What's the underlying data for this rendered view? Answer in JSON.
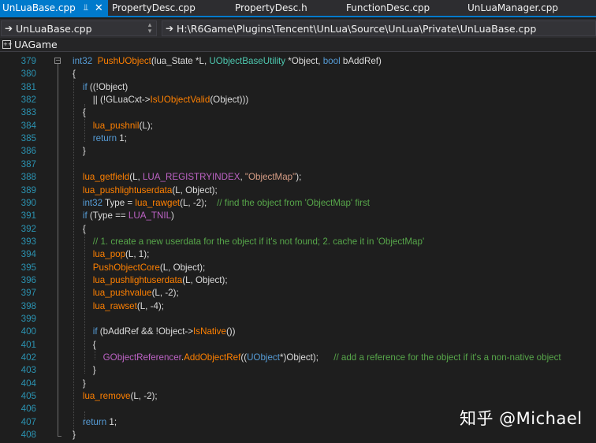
{
  "tabs": [
    {
      "label": "UnLuaBase.cpp",
      "active": true
    },
    {
      "label": "PropertyDesc.cpp",
      "active": false
    },
    {
      "label": "PropertyDesc.h",
      "active": false
    },
    {
      "label": "FunctionDesc.cpp",
      "active": false
    },
    {
      "label": "UnLuaManager.cpp",
      "active": false
    }
  ],
  "nav": {
    "file_combo": "UnLuaBase.cpp",
    "path_combo": "H:\\R6Game\\Plugins\\Tencent\\UnLua\\Source\\UnLua\\Private\\UnLuaBase.cpp"
  },
  "project": {
    "name": "UAGame"
  },
  "code_lines": [
    {
      "n": "379",
      "tokens": [
        [
          "kw",
          "int32"
        ],
        [
          "",
          "  "
        ],
        [
          "fn",
          "PushUObject"
        ],
        [
          "",
          "(lua_State *L, "
        ],
        [
          "ty",
          "UObjectBaseUtility"
        ],
        [
          "",
          " *Object, "
        ],
        [
          "kw",
          "bool"
        ],
        [
          "",
          " bAddRef)"
        ]
      ]
    },
    {
      "n": "380",
      "tokens": [
        [
          "",
          "{"
        ]
      ]
    },
    {
      "n": "381",
      "tokens": [
        [
          "",
          "    "
        ],
        [
          "kw",
          "if"
        ],
        [
          "",
          " ((!Object)"
        ]
      ]
    },
    {
      "n": "382",
      "tokens": [
        [
          "",
          "        || (!GLuaCxt->"
        ],
        [
          "fn",
          "IsUObjectValid"
        ],
        [
          "",
          "(Object)))"
        ]
      ]
    },
    {
      "n": "383",
      "tokens": [
        [
          "",
          "    {"
        ]
      ]
    },
    {
      "n": "384",
      "tokens": [
        [
          "",
          "        "
        ],
        [
          "fn",
          "lua_pushnil"
        ],
        [
          "",
          "(L);"
        ]
      ]
    },
    {
      "n": "385",
      "tokens": [
        [
          "",
          "        "
        ],
        [
          "kw",
          "return"
        ],
        [
          "",
          " 1;"
        ]
      ]
    },
    {
      "n": "386",
      "tokens": [
        [
          "",
          "    }"
        ]
      ]
    },
    {
      "n": "387",
      "tokens": []
    },
    {
      "n": "388",
      "tokens": [
        [
          "",
          "    "
        ],
        [
          "fn",
          "lua_getfield"
        ],
        [
          "",
          "(L, "
        ],
        [
          "mac",
          "LUA_REGISTRYINDEX"
        ],
        [
          "",
          ", "
        ],
        [
          "st",
          "\"ObjectMap\""
        ],
        [
          "",
          ");"
        ]
      ]
    },
    {
      "n": "389",
      "tokens": [
        [
          "",
          "    "
        ],
        [
          "fn",
          "lua_pushlightuserdata"
        ],
        [
          "",
          "(L, Object);"
        ]
      ]
    },
    {
      "n": "390",
      "tokens": [
        [
          "",
          "    "
        ],
        [
          "kw",
          "int32"
        ],
        [
          "",
          " Type = "
        ],
        [
          "fn",
          "lua_rawget"
        ],
        [
          "",
          "(L, -2);    "
        ],
        [
          "cm",
          "// find the object from 'ObjectMap' first"
        ]
      ]
    },
    {
      "n": "391",
      "tokens": [
        [
          "",
          "    "
        ],
        [
          "kw",
          "if"
        ],
        [
          "",
          " (Type == "
        ],
        [
          "mac",
          "LUA_TNIL"
        ],
        [
          "",
          ")"
        ]
      ]
    },
    {
      "n": "392",
      "tokens": [
        [
          "",
          "    {"
        ]
      ]
    },
    {
      "n": "393",
      "tokens": [
        [
          "",
          "        "
        ],
        [
          "cm",
          "// 1. create a new userdata for the object if it's not found; 2. cache it in 'ObjectMap'"
        ]
      ]
    },
    {
      "n": "394",
      "tokens": [
        [
          "",
          "        "
        ],
        [
          "fn",
          "lua_pop"
        ],
        [
          "",
          "(L, 1);"
        ]
      ]
    },
    {
      "n": "395",
      "tokens": [
        [
          "",
          "        "
        ],
        [
          "fn",
          "PushObjectCore"
        ],
        [
          "",
          "(L, Object);"
        ]
      ]
    },
    {
      "n": "396",
      "tokens": [
        [
          "",
          "        "
        ],
        [
          "fn",
          "lua_pushlightuserdata"
        ],
        [
          "",
          "(L, Object);"
        ]
      ]
    },
    {
      "n": "397",
      "tokens": [
        [
          "",
          "        "
        ],
        [
          "fn",
          "lua_pushvalue"
        ],
        [
          "",
          "(L, -2);"
        ]
      ]
    },
    {
      "n": "398",
      "tokens": [
        [
          "",
          "        "
        ],
        [
          "fn",
          "lua_rawset"
        ],
        [
          "",
          "(L, -4);"
        ]
      ]
    },
    {
      "n": "399",
      "tokens": []
    },
    {
      "n": "400",
      "tokens": [
        [
          "",
          "        "
        ],
        [
          "kw",
          "if"
        ],
        [
          "",
          " (bAddRef && !Object->"
        ],
        [
          "fn",
          "IsNative"
        ],
        [
          "",
          "())"
        ]
      ]
    },
    {
      "n": "401",
      "tokens": [
        [
          "",
          "        {"
        ]
      ]
    },
    {
      "n": "402",
      "tokens": [
        [
          "",
          "            "
        ],
        [
          "mac",
          "GObjectReferencer"
        ],
        [
          "",
          "."
        ],
        [
          "fn",
          "AddObjectRef"
        ],
        [
          "",
          "(("
        ],
        [
          "kw",
          "UObject"
        ],
        [
          "",
          "*)Object);      "
        ],
        [
          "cm",
          "// add a reference for the object if it's a non-native object"
        ]
      ]
    },
    {
      "n": "403",
      "tokens": [
        [
          "",
          "        }"
        ]
      ]
    },
    {
      "n": "404",
      "tokens": [
        [
          "",
          "    }"
        ]
      ]
    },
    {
      "n": "405",
      "tokens": [
        [
          "",
          "    "
        ],
        [
          "fn",
          "lua_remove"
        ],
        [
          "",
          "(L, -2);"
        ]
      ]
    },
    {
      "n": "406",
      "tokens": []
    },
    {
      "n": "407",
      "tokens": [
        [
          "",
          "    "
        ],
        [
          "kw",
          "return"
        ],
        [
          "",
          " 1;"
        ]
      ]
    },
    {
      "n": "408",
      "tokens": [
        [
          "",
          "}"
        ]
      ]
    }
  ],
  "watermark": "知乎 @Michael",
  "colors": {
    "accent": "#007acc",
    "line_number": "#2b91af",
    "keyword": "#569cd6",
    "function": "#ff8000",
    "comment": "#57a64a",
    "macro": "#bd63c5",
    "string": "#d69d85"
  }
}
